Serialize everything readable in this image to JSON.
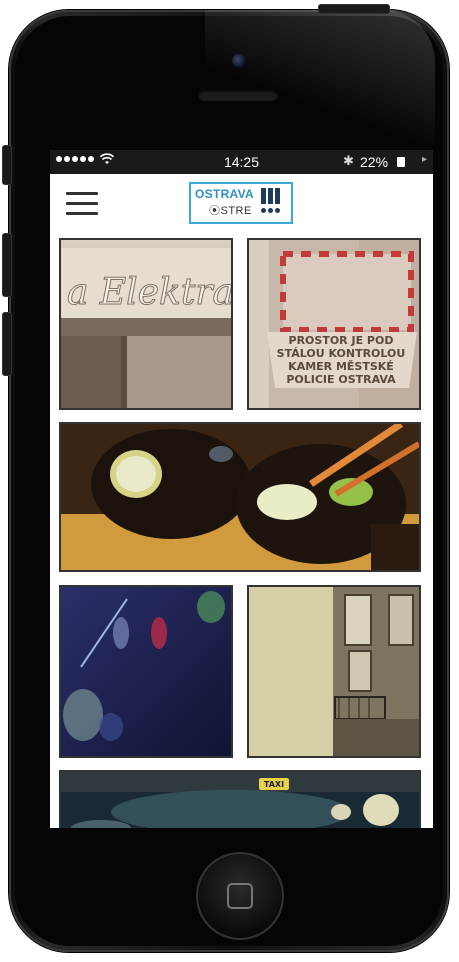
{
  "status_bar": {
    "signal_icon": "signal-dots-icon",
    "wifi_icon": "wifi-icon",
    "time": "14:25",
    "bluetooth_icon": "bluetooth-icon",
    "battery_percent": "22%",
    "battery_icon": "battery-icon"
  },
  "app_bar": {
    "menu_icon": "hamburger-menu-icon",
    "logo": {
      "line1": "OSTRAVA",
      "line2": "⦿STRE"
    }
  },
  "gallery": {
    "tiles": [
      {
        "name": "photo-elektra-sign",
        "sign_text": "a Elektra"
      },
      {
        "name": "photo-police-sign",
        "sign_text": [
          "PROSTOR JE POD",
          "STÁLOU KONTROLOU",
          "KAMER MĚSTSKÉ",
          "POLICIE OSTRAVA"
        ]
      },
      {
        "name": "photo-drinks"
      },
      {
        "name": "photo-night-lights"
      },
      {
        "name": "photo-building-wall"
      },
      {
        "name": "photo-taxi-night",
        "sign_text": "TAXI"
      }
    ]
  },
  "colors": {
    "logo_border": "#3aa8d8",
    "logo_text": "#2d8fc4",
    "logo_marks": "#203a5c"
  }
}
